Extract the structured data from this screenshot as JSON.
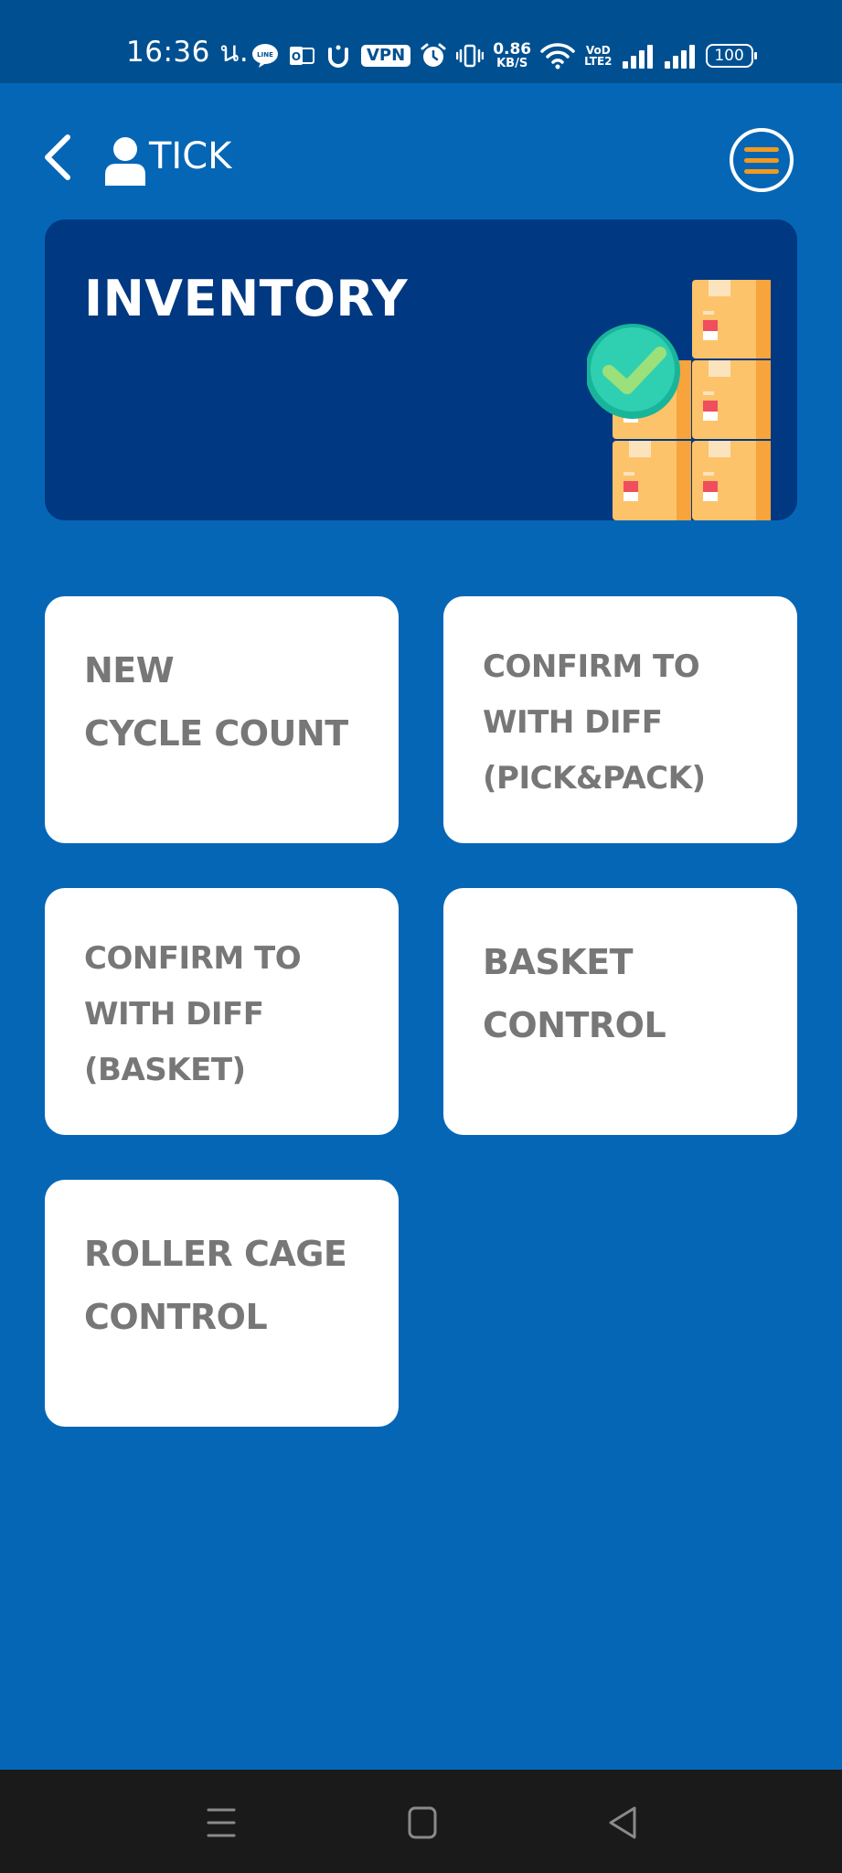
{
  "status_bar": {
    "time": "16:36 น.",
    "vpn_label": "VPN",
    "net_speed_value": "0.86",
    "net_speed_unit": "KB/S",
    "volte_top": "VoD",
    "volte_bottom": "LTE2",
    "battery_level": "100",
    "icons": [
      "line-icon",
      "outlook-icon",
      "u-icon",
      "vpn-icon",
      "alarm-icon",
      "vibrate-icon",
      "wifi-icon",
      "signal-icon",
      "signal-icon",
      "battery-icon"
    ]
  },
  "header": {
    "user_name": "TICK",
    "back_icon": "chevron-left-icon",
    "user_icon": "person-icon",
    "menu_icon": "hamburger-menu-icon"
  },
  "banner": {
    "title": "INVENTORY",
    "illustration": "boxes-with-checkmark-icon"
  },
  "tiles": [
    {
      "lines": [
        "NEW",
        "CYCLE COUNT"
      ]
    },
    {
      "lines": [
        "CONFIRM TO",
        "WITH DIFF",
        "(PICK&PACK)"
      ]
    },
    {
      "lines": [
        "CONFIRM TO",
        "WITH DIFF",
        "(BASKET)"
      ]
    },
    {
      "lines": [
        "BASKET",
        "CONTROL"
      ]
    },
    {
      "lines": [
        "ROLLER CAGE",
        "CONTROL"
      ]
    }
  ],
  "nav_bar": {
    "buttons": [
      "recent-apps-icon",
      "home-icon",
      "back-triangle-icon"
    ]
  },
  "colors": {
    "background": "#0566B6",
    "status_bar": "#005091",
    "banner": "#003882",
    "tile": "#FFFFFF",
    "tile_text": "#777777",
    "menu_accent": "#F39A1E",
    "nav_bar": "#1A1A1A"
  }
}
